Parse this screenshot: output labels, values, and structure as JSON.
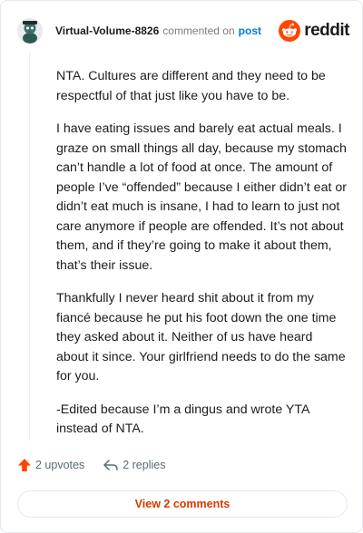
{
  "header": {
    "username": "Virtual-Volume-8826",
    "action": "commented on",
    "post_link": "post",
    "logo_text": "reddit"
  },
  "comment": {
    "paragraphs": [
      "NTA. Cultures are different and they need to be respectful of that just like you have to be.",
      "I have eating issues and barely eat actual meals. I graze on small things all day, because my stomach can’t handle a lot of food at once. The amount of people I’ve “offended” because I either didn’t eat or didn’t eat much is insane, I had to learn to just not care anymore if people are offended. It’s not about them, and if they’re going to make it about them, that’s their issue.",
      "Thankfully I never heard shit about it from my fiancé because he put his foot down the one time they asked about it. Neither of us have heard about it since. Your girlfriend needs to do the same for you.",
      "-Edited because I’m a dingus and wrote YTA instead of NTA."
    ]
  },
  "actions": {
    "upvotes": "2 upvotes",
    "replies": "2 replies"
  },
  "view_comments": "View 2 comments",
  "colors": {
    "reddit_orange": "#ff4500",
    "link_blue": "#0079d3",
    "button_text": "#d93a00"
  }
}
